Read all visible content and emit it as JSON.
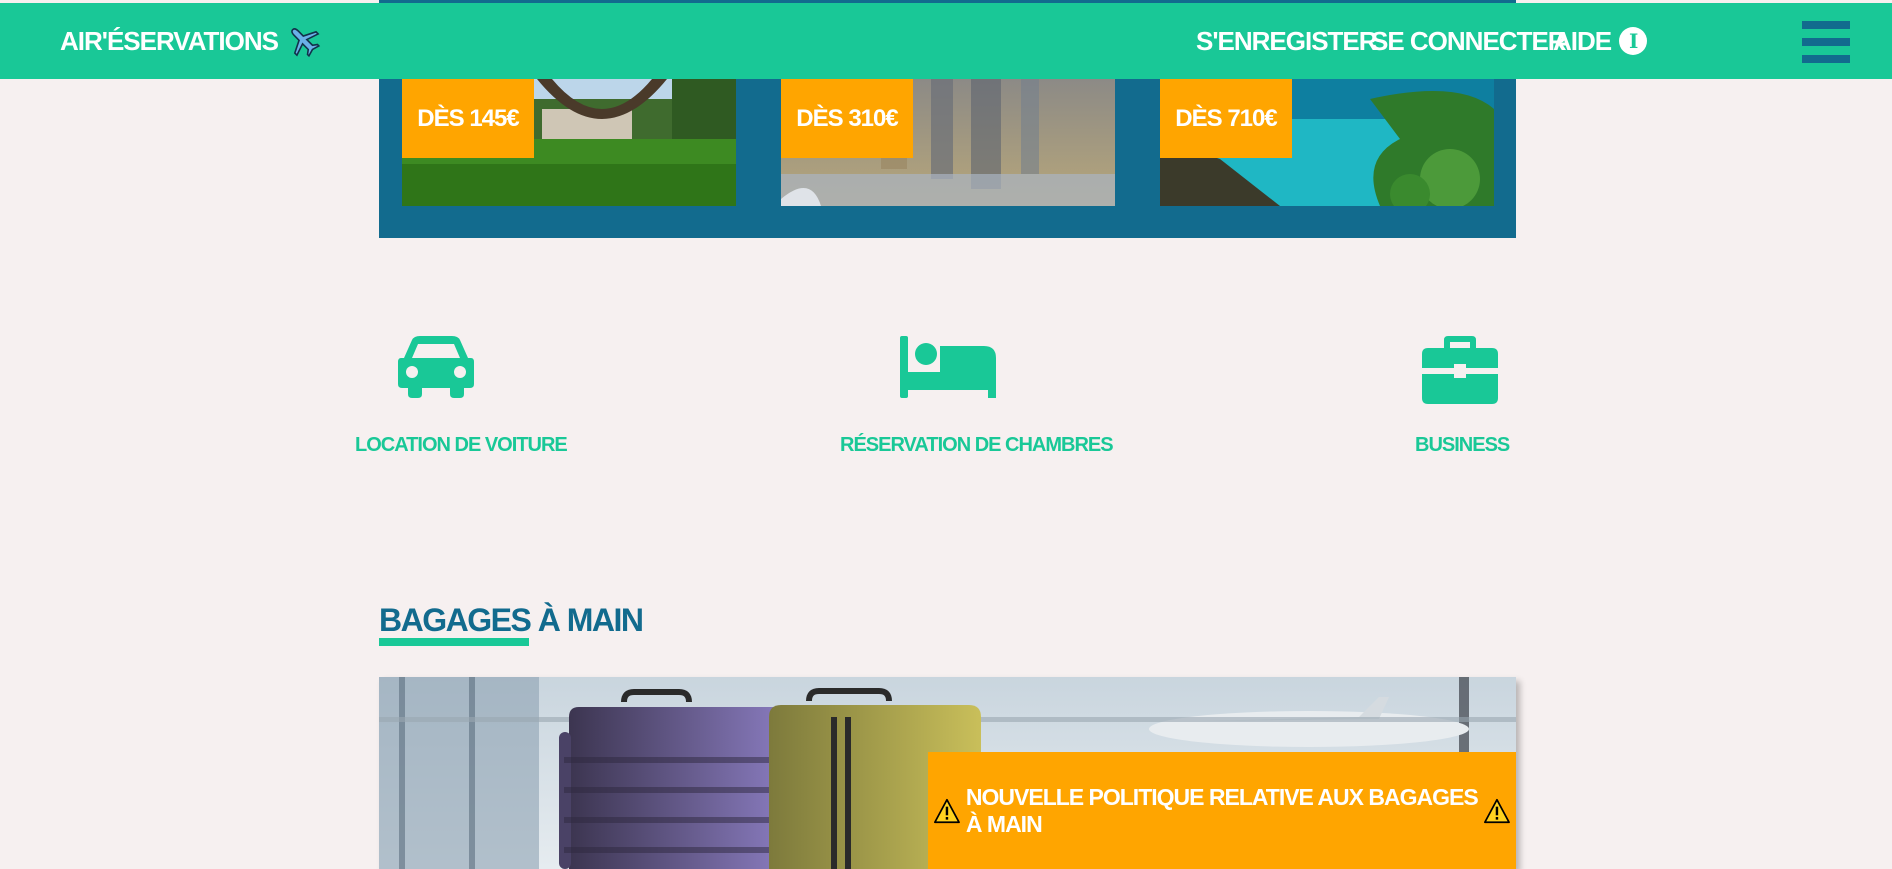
{
  "header": {
    "brand": "AIR'ÉSERVATIONS",
    "brand_icon": "airplane-icon",
    "nav": {
      "register": "S'ENREGISTER",
      "login": "SE CONNECTER",
      "help": "AIDE"
    },
    "menu_icon": "hamburger-menu-icon"
  },
  "offers": [
    {
      "price": "DÈS 145€",
      "image": "eiffel-tower-park-image"
    },
    {
      "price": "DÈS 310€",
      "image": "city-water-reflection-image"
    },
    {
      "price": "DÈS 710€",
      "image": "tropical-lagoon-image"
    }
  ],
  "services": [
    {
      "label": "LOCATION DE VOITURE",
      "icon": "car-icon"
    },
    {
      "label": "RÉSERVATION DE CHAMBRES",
      "icon": "bed-icon"
    },
    {
      "label": "BUSINESS",
      "icon": "briefcase-icon"
    }
  ],
  "luggage_section": {
    "title": "BAGAGES À MAIN",
    "notice": "NOUVELLE POLITIQUE RELATIVE AUX BAGAGES À MAIN",
    "notice_icon": "warning-icon",
    "image": "suitcases-airport-image"
  },
  "colors": {
    "primary": "#19c897",
    "secondary": "#126b8e",
    "accent": "#ffa500",
    "background": "#f6f0f0"
  }
}
